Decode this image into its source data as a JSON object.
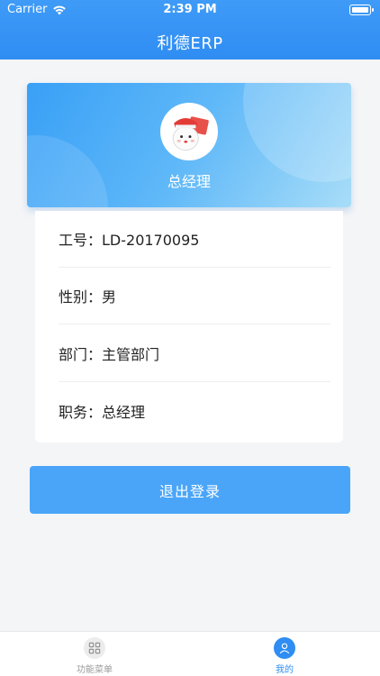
{
  "status_bar": {
    "carrier": "Carrier",
    "time": "2:39 PM"
  },
  "nav": {
    "title": "利德ERP"
  },
  "profile": {
    "name": "总经理"
  },
  "info": [
    "工号：LD-20170095",
    "性别：男",
    "部门：主管部门",
    "职务：总经理"
  ],
  "logout_label": "退出登录",
  "tabs": [
    {
      "label": "功能菜单",
      "icon": "grid-menu-icon",
      "active": false
    },
    {
      "label": "我的",
      "icon": "user-icon",
      "active": true
    }
  ],
  "colors": {
    "primary": "#2f8df3",
    "button": "#4aa5f8",
    "background": "#f4f5f7"
  }
}
